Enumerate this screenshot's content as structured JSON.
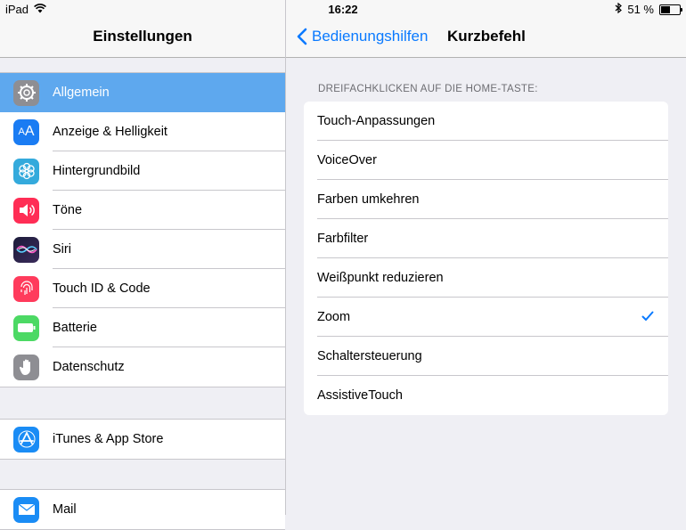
{
  "status_bar": {
    "device": "iPad",
    "time": "16:22",
    "battery": "51 %",
    "battery_level": 0.51
  },
  "master": {
    "title": "Einstellungen",
    "group1": [
      {
        "label": "Allgemein",
        "icon": "gear-icon",
        "color": "#8e8e93",
        "selected": true
      },
      {
        "label": "Anzeige & Helligkeit",
        "icon": "text-size-icon",
        "color": "#1a7cf3"
      },
      {
        "label": "Hintergrundbild",
        "icon": "flower-icon",
        "color": "#34aadc"
      },
      {
        "label": "Töne",
        "icon": "speaker-icon",
        "color": "#ff2d55"
      },
      {
        "label": "Siri",
        "icon": "siri-icon",
        "color": "#1c1c3a"
      },
      {
        "label": "Touch ID & Code",
        "icon": "fingerprint-icon",
        "color": "#ff3b5c"
      },
      {
        "label": "Batterie",
        "icon": "battery-icon",
        "color": "#4cd964"
      },
      {
        "label": "Datenschutz",
        "icon": "hand-icon",
        "color": "#8e8e93"
      }
    ],
    "group2": [
      {
        "label": "iTunes & App Store",
        "icon": "app-store-icon",
        "color": "#1a8cf5"
      }
    ],
    "group3": [
      {
        "label": "Mail",
        "icon": "mail-icon",
        "color": "#1a8cf5"
      }
    ]
  },
  "detail": {
    "back_label": "Bedienungshilfen",
    "title": "Kurzbefehl",
    "section_header": "DREIFACHKLICKEN AUF DIE HOME-TASTE:",
    "options": [
      {
        "label": "Touch-Anpassungen",
        "checked": false
      },
      {
        "label": "VoiceOver",
        "checked": false
      },
      {
        "label": "Farben umkehren",
        "checked": false
      },
      {
        "label": "Farbfilter",
        "checked": false
      },
      {
        "label": "Weißpunkt reduzieren",
        "checked": false
      },
      {
        "label": "Zoom",
        "checked": true
      },
      {
        "label": "Schaltersteuerung",
        "checked": false
      },
      {
        "label": "AssistiveTouch",
        "checked": false
      }
    ]
  },
  "colors": {
    "accent": "#0a7aff",
    "selected_row": "#5ea8ee"
  }
}
